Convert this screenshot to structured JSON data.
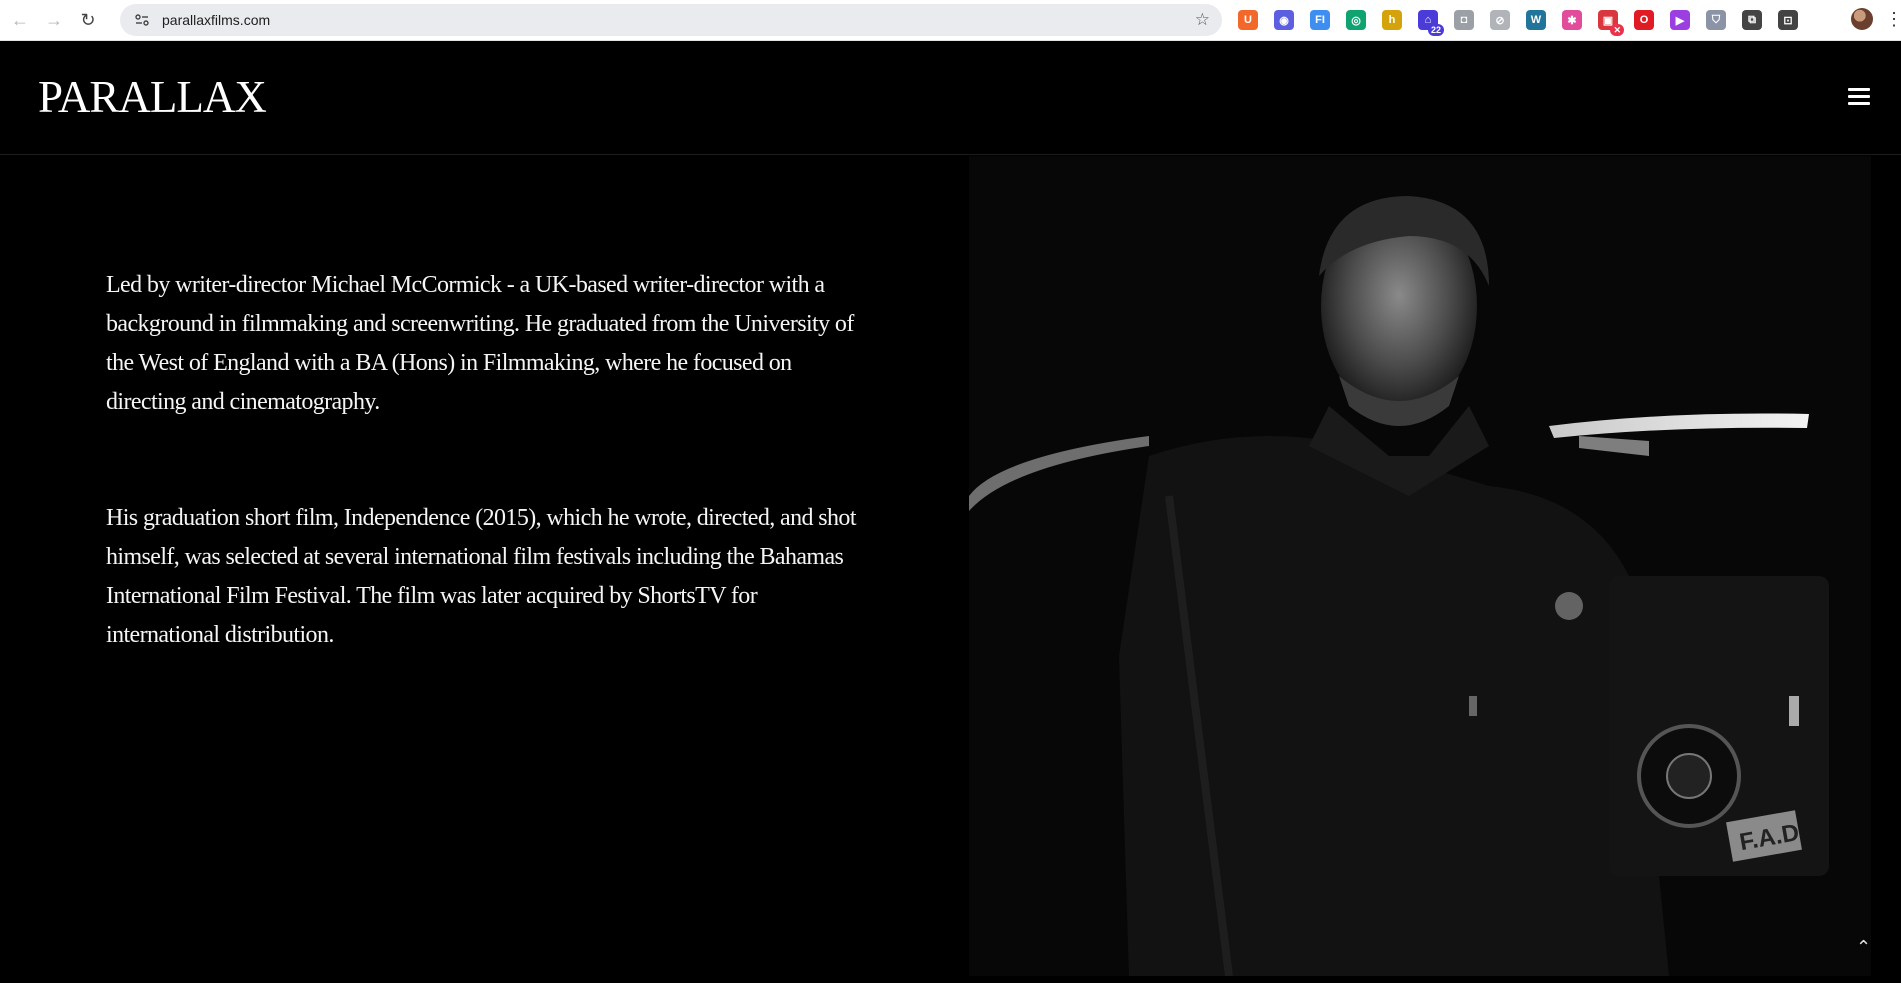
{
  "browser": {
    "url": "parallaxfilms.com",
    "back_icon": "arrow-left-icon",
    "forward_icon": "arrow-right-icon",
    "reload_icon": "reload-icon",
    "extensions": [
      {
        "name": "u-extension-icon",
        "color": "#f2682a",
        "glyph": "U"
      },
      {
        "name": "blue-circle-extension-icon",
        "color": "#5b5fe0",
        "glyph": "◉"
      },
      {
        "name": "fi-extension-icon",
        "color": "#3d8ef0",
        "glyph": "FI"
      },
      {
        "name": "green-circle-extension-icon",
        "color": "#0ea36f",
        "glyph": "◎"
      },
      {
        "name": "yellow-box-extension-icon",
        "color": "#d4a20b",
        "glyph": "h"
      },
      {
        "name": "house-badge-extension-icon",
        "color": "#4b3bd8",
        "glyph": "⌂",
        "badge": "22"
      },
      {
        "name": "camera-extension-icon",
        "color": "#9aa0a6",
        "glyph": "◘"
      },
      {
        "name": "compass-extension-icon",
        "color": "#b0b4b8",
        "glyph": "⊘"
      },
      {
        "name": "wordpress-extension-icon",
        "color": "#21759b",
        "glyph": "W"
      },
      {
        "name": "pinwheel-extension-icon",
        "color": "#e14d9b",
        "glyph": "✱"
      },
      {
        "name": "red-box-extension-icon",
        "color": "#d9363e",
        "glyph": "▣",
        "badge": "✕"
      },
      {
        "name": "opera-extension-icon",
        "color": "#e01b24",
        "glyph": "O"
      },
      {
        "name": "purple-extension-icon",
        "color": "#9b3fe0",
        "glyph": "▶"
      },
      {
        "name": "shield-extension-icon",
        "color": "#8b93a6",
        "glyph": "⛉"
      },
      {
        "name": "puzzle-extension-icon",
        "color": "#444",
        "glyph": "⧉"
      },
      {
        "name": "tab-search-icon",
        "color": "#444",
        "glyph": "⊡"
      }
    ]
  },
  "site": {
    "logo": "PARALLAX",
    "menu_icon": "hamburger-menu-icon"
  },
  "bio": {
    "paragraph_1": "Led by writer-director Michael McCormick - a UK-based writer-director with a background in filmmaking and screenwriting. He graduated from the University of the West of England with a BA (Hons) in Filmmaking, where he focused on directing and cinematography.",
    "paragraph_2": "His graduation short film, Independence (2015), which he wrote, directed, and shot himself, was selected at several international film festivals including the Bahamas International Film Festival. The film was later acquired by ShortsTV for international distribution."
  },
  "photo": {
    "subject": "black-and-white photo of a man standing beside a film camera"
  }
}
